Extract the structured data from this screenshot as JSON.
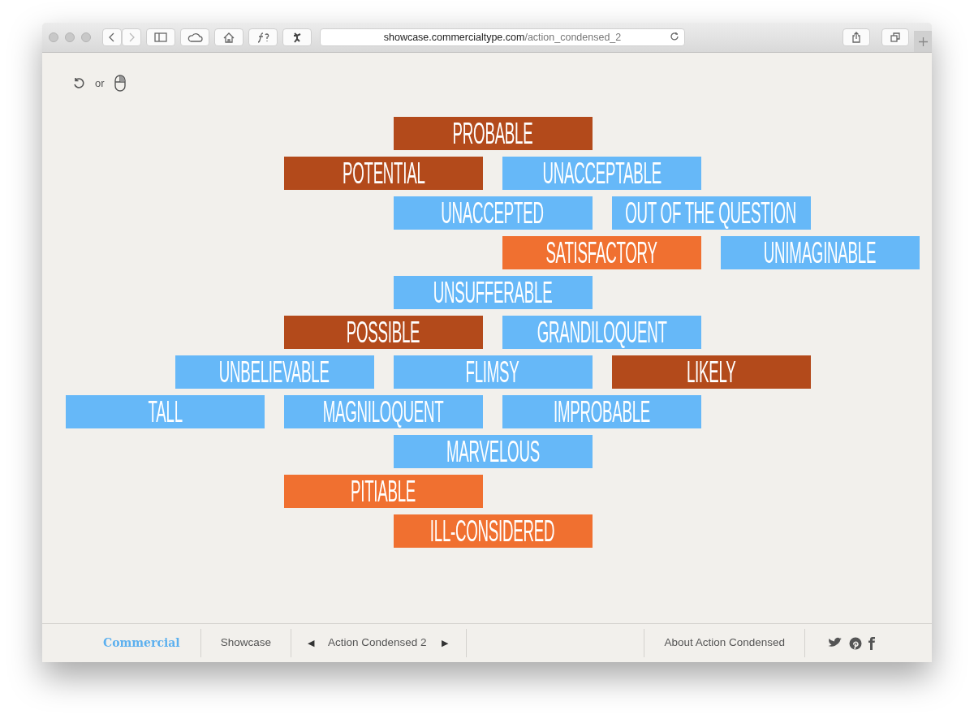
{
  "browser": {
    "url_host": "showcase.commercialtype.com",
    "url_path": "/action_condensed_2"
  },
  "hint": {
    "or_label": "or"
  },
  "words": [
    {
      "text": "PROBABLE",
      "color": "#b34a1b"
    },
    {
      "text": "POTENTIAL",
      "color": "#b34a1b"
    },
    {
      "text": "UNACCEPTABLE",
      "color": "#66b8f8"
    },
    {
      "text": "UNACCEPTED",
      "color": "#66b8f8"
    },
    {
      "text": "OUT OF THE QUESTION",
      "color": "#66b8f8"
    },
    {
      "text": "SATISFACTORY",
      "color": "#f07030"
    },
    {
      "text": "UNIMAGINABLE",
      "color": "#66b8f8"
    },
    {
      "text": "UNSUFFERABLE",
      "color": "#66b8f8"
    },
    {
      "text": "POSSIBLE",
      "color": "#b34a1b"
    },
    {
      "text": "GRANDILOQUENT",
      "color": "#66b8f8"
    },
    {
      "text": "UNBELIEVABLE",
      "color": "#66b8f8"
    },
    {
      "text": "FLIMSY",
      "color": "#66b8f8"
    },
    {
      "text": "LIKELY",
      "color": "#b34a1b"
    },
    {
      "text": "TALL",
      "color": "#66b8f8"
    },
    {
      "text": "MAGNILOQUENT",
      "color": "#66b8f8"
    },
    {
      "text": "IMPROBABLE",
      "color": "#66b8f8"
    },
    {
      "text": "MARVELOUS",
      "color": "#66b8f8"
    },
    {
      "text": "PITIABLE",
      "color": "#f07030"
    },
    {
      "text": "ILL-CONSIDERED",
      "color": "#f07030"
    }
  ],
  "footer": {
    "logo": "Commercial",
    "showcase": "Showcase",
    "prev": "◀",
    "family": "Action Condensed 2",
    "next": "▶",
    "about": "About Action Condensed"
  }
}
